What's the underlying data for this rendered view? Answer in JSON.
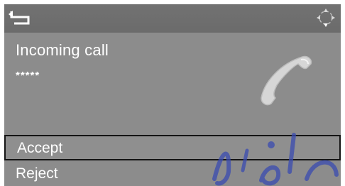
{
  "screen": {
    "title": "Incoming call",
    "caller_number": "*****",
    "colors": {
      "panel": "#8c8c8c",
      "topbar": "#6e6e6e",
      "text": "#ffffff",
      "selection_border": "#141414"
    }
  },
  "topbar": {
    "back_icon": "back-arrow-icon",
    "nav_icon": "controller-arrows-icon"
  },
  "menu": {
    "items": [
      {
        "label": "Accept",
        "selected": true
      },
      {
        "label": "Reject",
        "selected": false
      }
    ]
  }
}
